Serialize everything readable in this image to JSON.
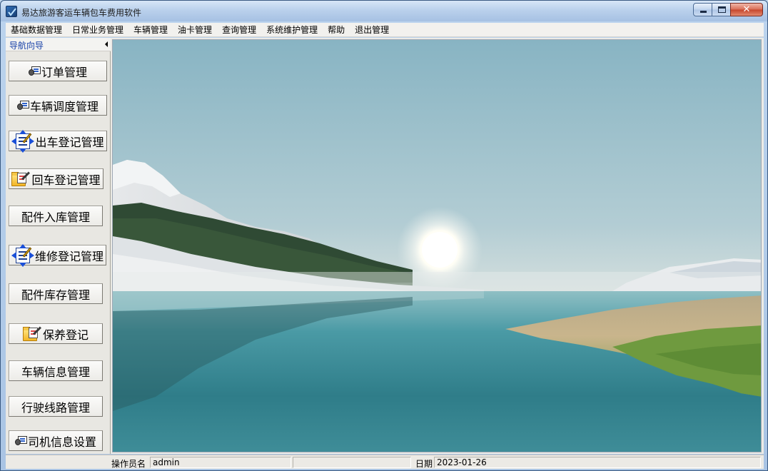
{
  "window": {
    "title": "易达旅游客运车辆包车费用软件",
    "controls": {
      "minimize": "minimize-icon",
      "maximize": "maximize-icon",
      "close": "✕"
    }
  },
  "menu": [
    "基础数据管理",
    "日常业务管理",
    "车辆管理",
    "油卡管理",
    "查询管理",
    "系统维护管理",
    "帮助",
    "退出管理"
  ],
  "nav": {
    "title": "导航向导",
    "buttons": [
      {
        "label": "订单管理",
        "icon": "order-icon"
      },
      {
        "label": "车辆调度管理",
        "icon": "order-icon"
      },
      {
        "label": "出车登记管理",
        "icon": "form-edit-icon"
      },
      {
        "label": "回车登记管理",
        "icon": "folder-edit-icon"
      },
      {
        "label": "配件入库管理",
        "icon": ""
      },
      {
        "label": "维修登记管理",
        "icon": "form-edit-icon"
      },
      {
        "label": "配件库存管理",
        "icon": ""
      },
      {
        "label": "保养登记",
        "icon": "folder-edit-icon"
      },
      {
        "label": "车辆信息管理",
        "icon": ""
      },
      {
        "label": "行驶线路管理",
        "icon": ""
      },
      {
        "label": "司机信息设置",
        "icon": "order-icon"
      }
    ]
  },
  "status": {
    "operator_label": "操作员名",
    "operator_value": "admin",
    "date_label": "日期",
    "date_value": "2023-01-26"
  }
}
